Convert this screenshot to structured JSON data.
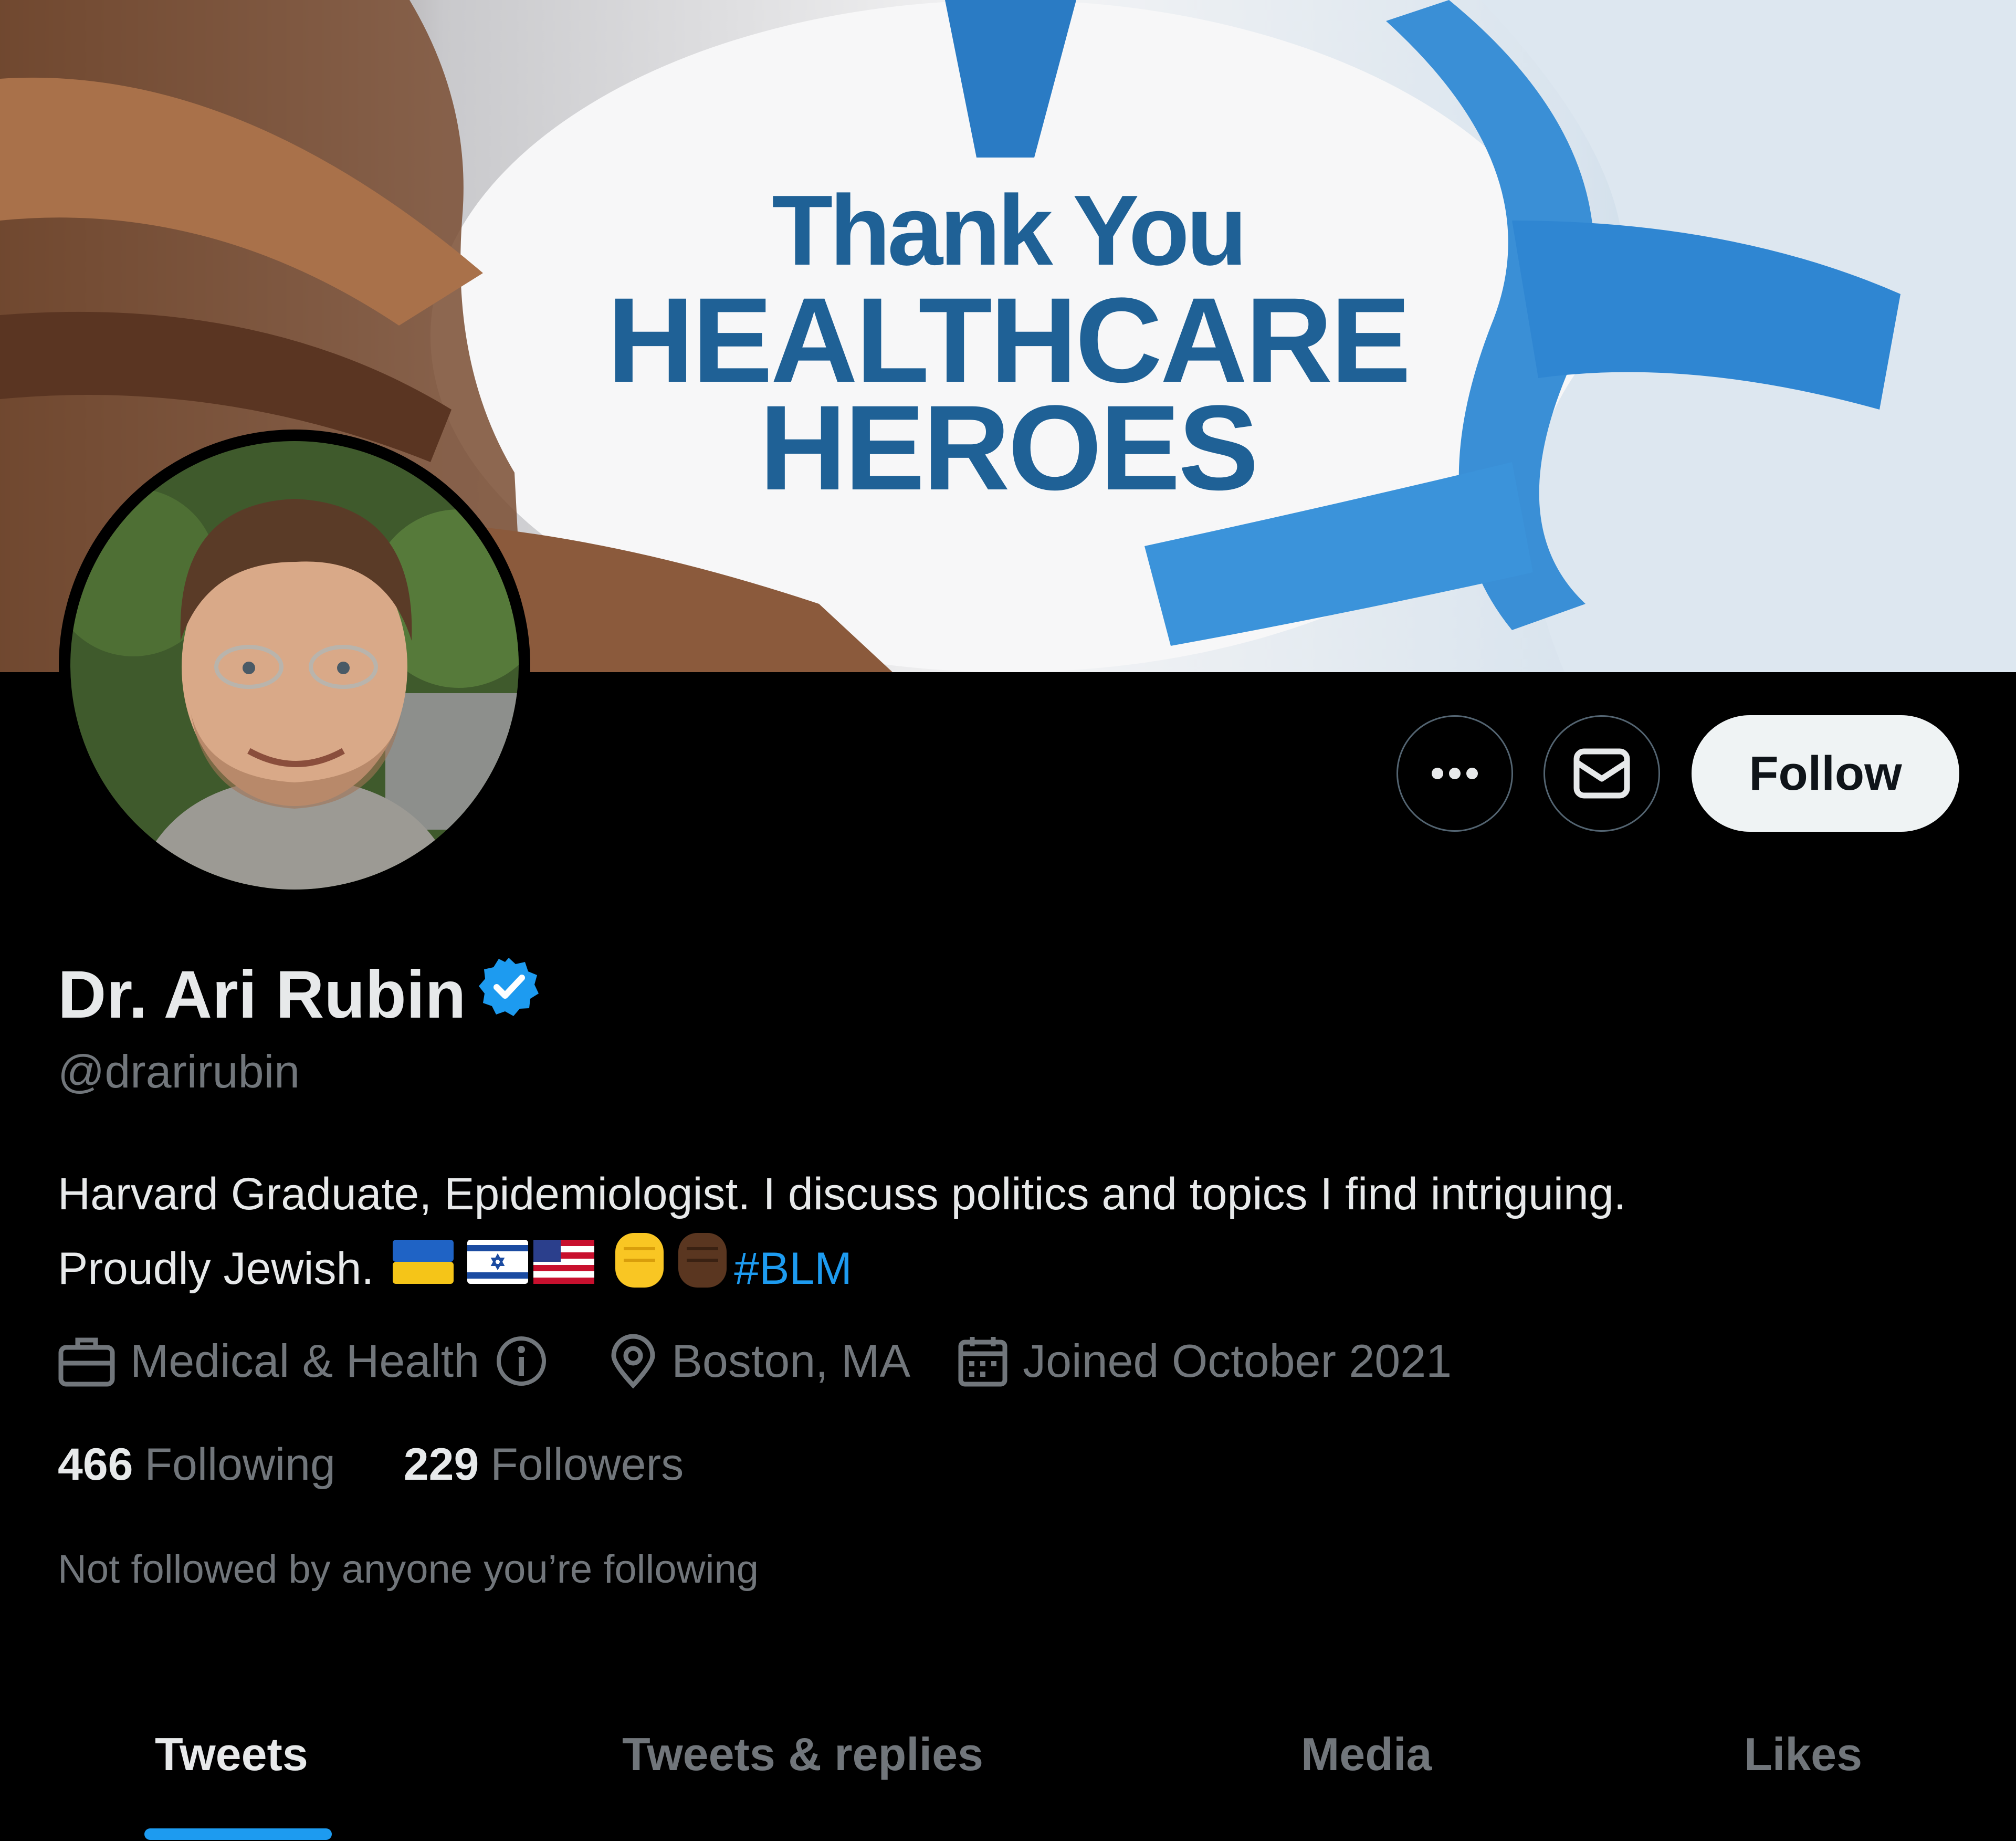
{
  "banner": {
    "line1": "Thank You",
    "line2": "HEALTHCARE",
    "line3": "HEROES"
  },
  "actions": {
    "more_icon": "more-horizontal-icon",
    "message_icon": "envelope-icon",
    "follow_label": "Follow"
  },
  "profile": {
    "name": "Dr. Ari Rubin",
    "verified_icon": "verified-badge-icon",
    "handle": "@drarirubin",
    "bio_line1": "Harvard Graduate, Epidemiologist. I discuss politics and topics I find intriguing.",
    "bio_line2": "Proudly Jewish.",
    "bio_hashtag": "#BLM"
  },
  "meta": {
    "category": "Medical & Health",
    "location": "Boston, MA",
    "joined": "Joined October 2021"
  },
  "stats": {
    "following_count": "466",
    "following_label": "Following",
    "followers_count": "229",
    "followers_label": "Followers"
  },
  "not_followed": "Not followed by anyone you’re following",
  "tabs": [
    {
      "label": "Tweets",
      "active": true
    },
    {
      "label": "Tweets & replies",
      "active": false
    },
    {
      "label": "Media",
      "active": false
    },
    {
      "label": "Likes",
      "active": false
    }
  ],
  "colors": {
    "background": "#000000",
    "accent": "#1d9bf0",
    "banner_text": "#1f6196",
    "secondary_text": "#71767b"
  }
}
